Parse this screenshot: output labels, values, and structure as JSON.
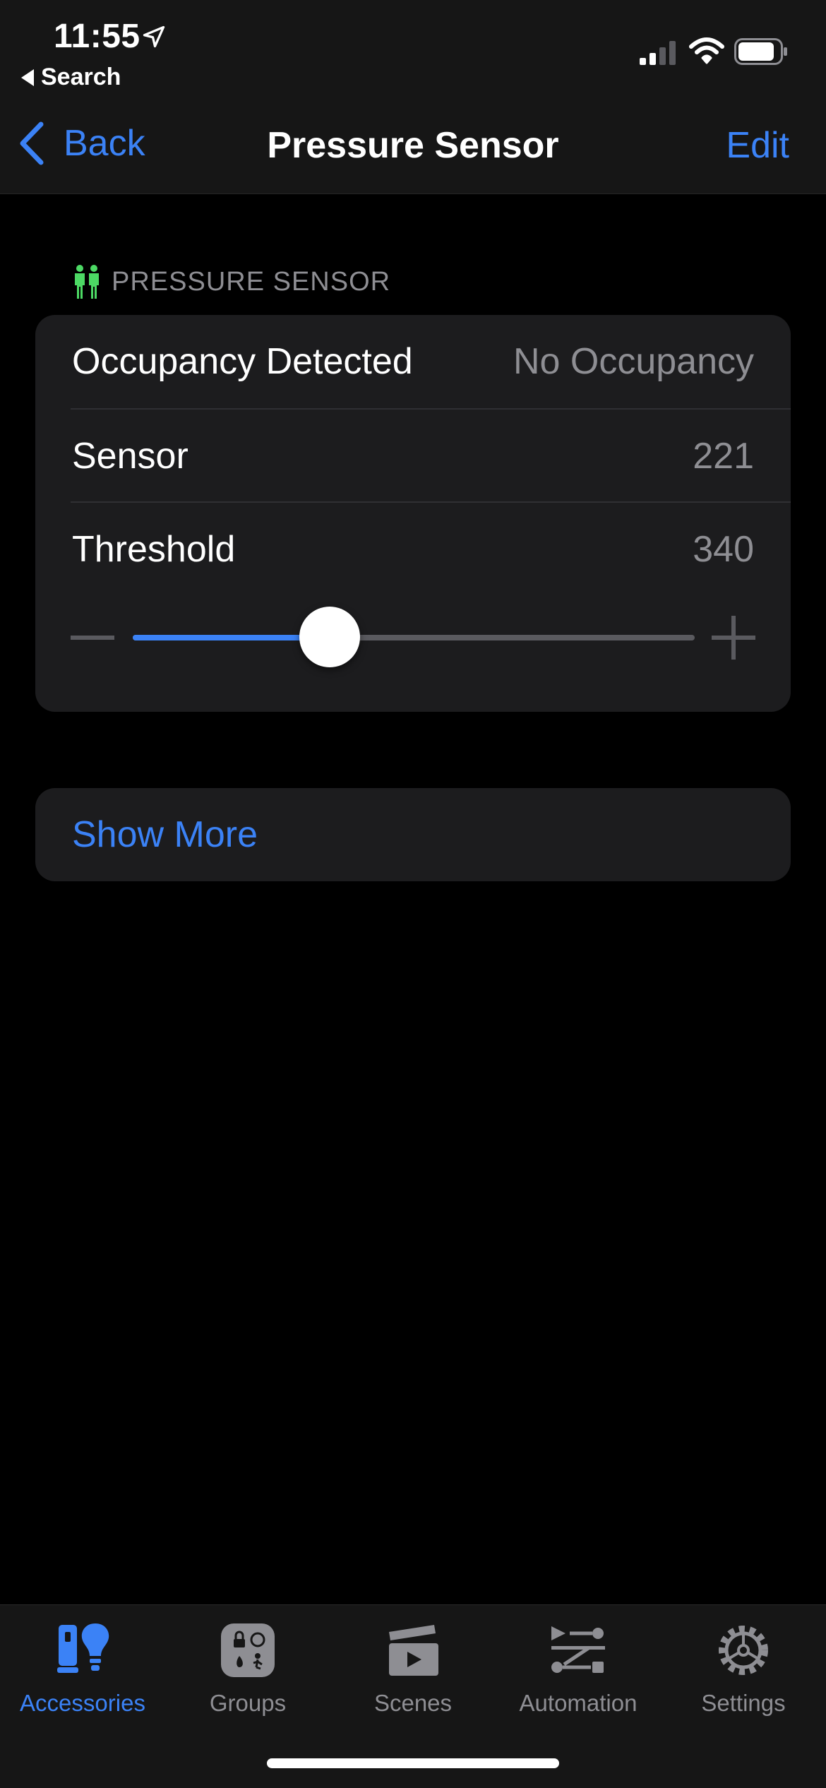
{
  "status_bar": {
    "time": "11:55",
    "back_app": "Search"
  },
  "nav": {
    "back_label": "Back",
    "title": "Pressure Sensor",
    "edit_label": "Edit"
  },
  "section": {
    "header": "PRESSURE SENSOR",
    "icon": "people-icon",
    "icon_color": "#4cd964"
  },
  "rows": [
    {
      "label": "Occupancy Detected",
      "value": "No Occupancy"
    },
    {
      "label": "Sensor",
      "value": "221"
    },
    {
      "label": "Threshold",
      "value": "340"
    }
  ],
  "slider": {
    "fraction": 0.35
  },
  "show_more": "Show More",
  "tabs": [
    {
      "label": "Accessories",
      "icon": "accessories-icon",
      "active": true
    },
    {
      "label": "Groups",
      "icon": "groups-icon",
      "active": false
    },
    {
      "label": "Scenes",
      "icon": "clapperboard-icon",
      "active": false
    },
    {
      "label": "Automation",
      "icon": "automation-icon",
      "active": false
    },
    {
      "label": "Settings",
      "icon": "gear-icon",
      "active": false
    }
  ],
  "colors": {
    "accent": "#3b82f6",
    "card": "#1c1c1e",
    "secondary_text": "#8e8e93"
  }
}
